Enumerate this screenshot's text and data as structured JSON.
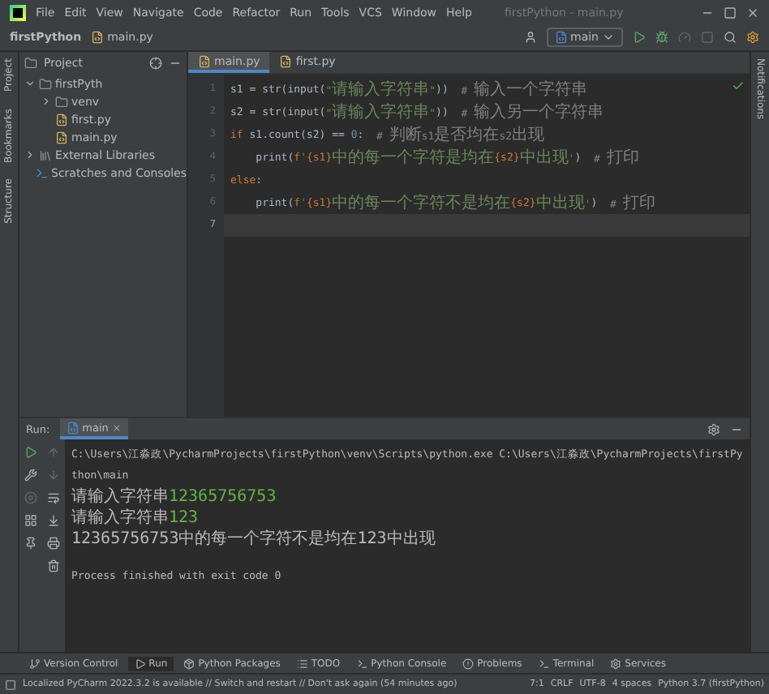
{
  "window": {
    "title": "firstPython - main.py",
    "menu": [
      "File",
      "Edit",
      "View",
      "Navigate",
      "Code",
      "Refactor",
      "Run",
      "Tools",
      "VCS",
      "Window",
      "Help"
    ]
  },
  "breadcrumb": [
    "firstPython",
    "main.py"
  ],
  "run_config": "main",
  "left_strip": [
    "Project",
    "Bookmarks",
    "Structure"
  ],
  "right_strip": [
    "Notifications"
  ],
  "project": {
    "title": "Project",
    "tree": [
      {
        "label": "firstPyth",
        "kind": "folder",
        "expanded": true,
        "children": [
          {
            "label": "venv",
            "kind": "folder",
            "expanded": false
          },
          {
            "label": "first.py",
            "kind": "file"
          },
          {
            "label": "main.py",
            "kind": "file"
          }
        ]
      },
      {
        "label": "External Libraries",
        "kind": "library",
        "expanded": false
      },
      {
        "label": "Scratches and Consoles",
        "kind": "scratch"
      }
    ]
  },
  "editor_tabs": [
    {
      "label": "main.py",
      "selected": true
    },
    {
      "label": "first.py",
      "selected": false
    }
  ],
  "code": [
    {
      "number": "1",
      "current": false,
      "tokens": [
        {
          "kind": "plain",
          "text": "s1 = str(input("
        },
        {
          "kind": "str",
          "text": "\"请输入字符串\""
        },
        {
          "kind": "plain",
          "text": "))  "
        },
        {
          "kind": "cmt",
          "text": "# 输入一个字符串"
        }
      ]
    },
    {
      "number": "2",
      "current": false,
      "tokens": [
        {
          "kind": "plain",
          "text": "s2 = str(input("
        },
        {
          "kind": "str",
          "text": "\"请输入字符串\""
        },
        {
          "kind": "plain",
          "text": "))  "
        },
        {
          "kind": "cmt",
          "text": "# 输入另一个字符串"
        }
      ]
    },
    {
      "number": "3",
      "current": false,
      "tokens": [
        {
          "kind": "kw",
          "text": "if "
        },
        {
          "kind": "plain",
          "text": "s1.count(s2) == "
        },
        {
          "kind": "num",
          "text": "0"
        },
        {
          "kind": "plain",
          "text": ":  "
        },
        {
          "kind": "cmt",
          "text": "# 判断s1是否均在s2出现"
        }
      ]
    },
    {
      "number": "4",
      "current": false,
      "tokens": [
        {
          "kind": "plain",
          "text": "    print("
        },
        {
          "kind": "kw",
          "text": "f"
        },
        {
          "kind": "str",
          "text": "'"
        },
        {
          "kind": "brace",
          "text": "{s1}"
        },
        {
          "kind": "str",
          "text": "中的每一个字符是均在"
        },
        {
          "kind": "brace",
          "text": "{s2}"
        },
        {
          "kind": "str",
          "text": "中出现'"
        },
        {
          "kind": "plain",
          "text": ")  "
        },
        {
          "kind": "cmt",
          "text": "# 打印"
        }
      ]
    },
    {
      "number": "5",
      "current": false,
      "tokens": [
        {
          "kind": "kw",
          "text": "else"
        },
        {
          "kind": "plain",
          "text": ":"
        }
      ]
    },
    {
      "number": "6",
      "current": false,
      "tokens": [
        {
          "kind": "plain",
          "text": "    print("
        },
        {
          "kind": "kw",
          "text": "f"
        },
        {
          "kind": "str",
          "text": "'"
        },
        {
          "kind": "brace",
          "text": "{s1}"
        },
        {
          "kind": "str",
          "text": "中的每一个字符不是均在"
        },
        {
          "kind": "brace",
          "text": "{s2}"
        },
        {
          "kind": "str",
          "text": "中出现'"
        },
        {
          "kind": "plain",
          "text": ")  "
        },
        {
          "kind": "cmt",
          "text": "# 打印"
        }
      ]
    },
    {
      "number": "7",
      "current": true
    }
  ],
  "run": {
    "label": "Run:",
    "tab": "main",
    "console": [
      {
        "kind": "command",
        "text": "C:\\Users\\江淼政\\PycharmProjects\\firstPython\\venv\\Scripts\\python.exe C:\\Users\\江淼政\\PycharmProjects\\firstPython\\main"
      },
      {
        "kind": "prompt",
        "text": "请输入字符串",
        "input": "12365756753"
      },
      {
        "kind": "prompt",
        "text": "请输入字符串",
        "input": "123"
      },
      {
        "kind": "output",
        "text": "12365756753中的每一个字符不是均在123中出现"
      },
      {
        "kind": "exit",
        "text": "Process finished with exit code 0"
      }
    ]
  },
  "tool_tabs": [
    {
      "label": "Version Control",
      "selected": false
    },
    {
      "label": "Run",
      "selected": true
    },
    {
      "label": "Python Packages",
      "selected": false
    },
    {
      "label": "TODO",
      "selected": false
    },
    {
      "label": "Python Console",
      "selected": false
    },
    {
      "label": "Problems",
      "selected": false
    },
    {
      "label": "Terminal",
      "selected": false
    },
    {
      "label": "Services",
      "selected": false
    }
  ],
  "status_bar": {
    "message": "Localized PyCharm 2022.3.2 is available // Switch and restart // Don't ask again (54 minutes ago)",
    "items": [
      "7:1",
      "CRLF",
      "UTF-8",
      "4 spaces",
      "Python 3.7 (firstPython)"
    ]
  }
}
